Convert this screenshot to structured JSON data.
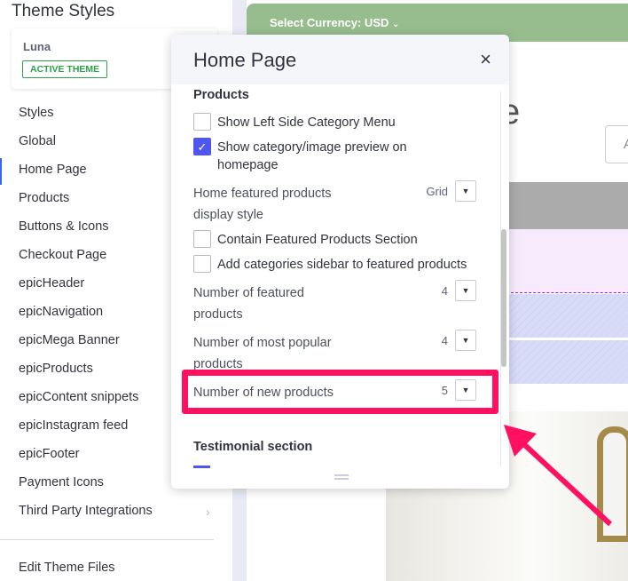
{
  "sidebar": {
    "title": "Theme Styles",
    "theme_name": "Luna",
    "theme_badge": "ACTIVE THEME",
    "items": [
      "Styles",
      "Global",
      "Home Page",
      "Products",
      "Buttons & Icons",
      "Checkout Page",
      "epicHeader",
      "epicNavigation",
      "epicMega Banner",
      "epicProducts",
      "epicContent snippets",
      "epicInstagram feed",
      "epicFooter",
      "Payment Icons",
      "Third Party Integrations"
    ],
    "active_item": "Home Page",
    "edit_files": "Edit Theme Files"
  },
  "preview": {
    "currency": "Select Currency: USD",
    "heading_fragment": "e",
    "search_fragment": "A"
  },
  "modal": {
    "title": "Home Page",
    "close": "×",
    "section_products": "Products",
    "show_left_menu": {
      "label": "Show Left Side Category Menu",
      "checked": false
    },
    "show_preview": {
      "label": "Show category/image preview on homepage",
      "checked": true
    },
    "featured_style": {
      "label": "Home featured products display style",
      "value": "Grid"
    },
    "contain_featured": {
      "label": "Contain Featured Products Section",
      "checked": false
    },
    "add_sidebar": {
      "label": "Add categories sidebar to featured products",
      "checked": false
    },
    "num_featured": {
      "label": "Number of featured products",
      "value": "4"
    },
    "num_popular": {
      "label": "Number of most popular products",
      "value": "4"
    },
    "num_new": {
      "label": "Number of new products",
      "value": "5"
    },
    "section_testimonial": "Testimonial section"
  },
  "colors": {
    "accent": "#5055f0",
    "highlight": "#ff1060",
    "currency_bar": "#97bd8f",
    "badge": "#2ea04a"
  }
}
